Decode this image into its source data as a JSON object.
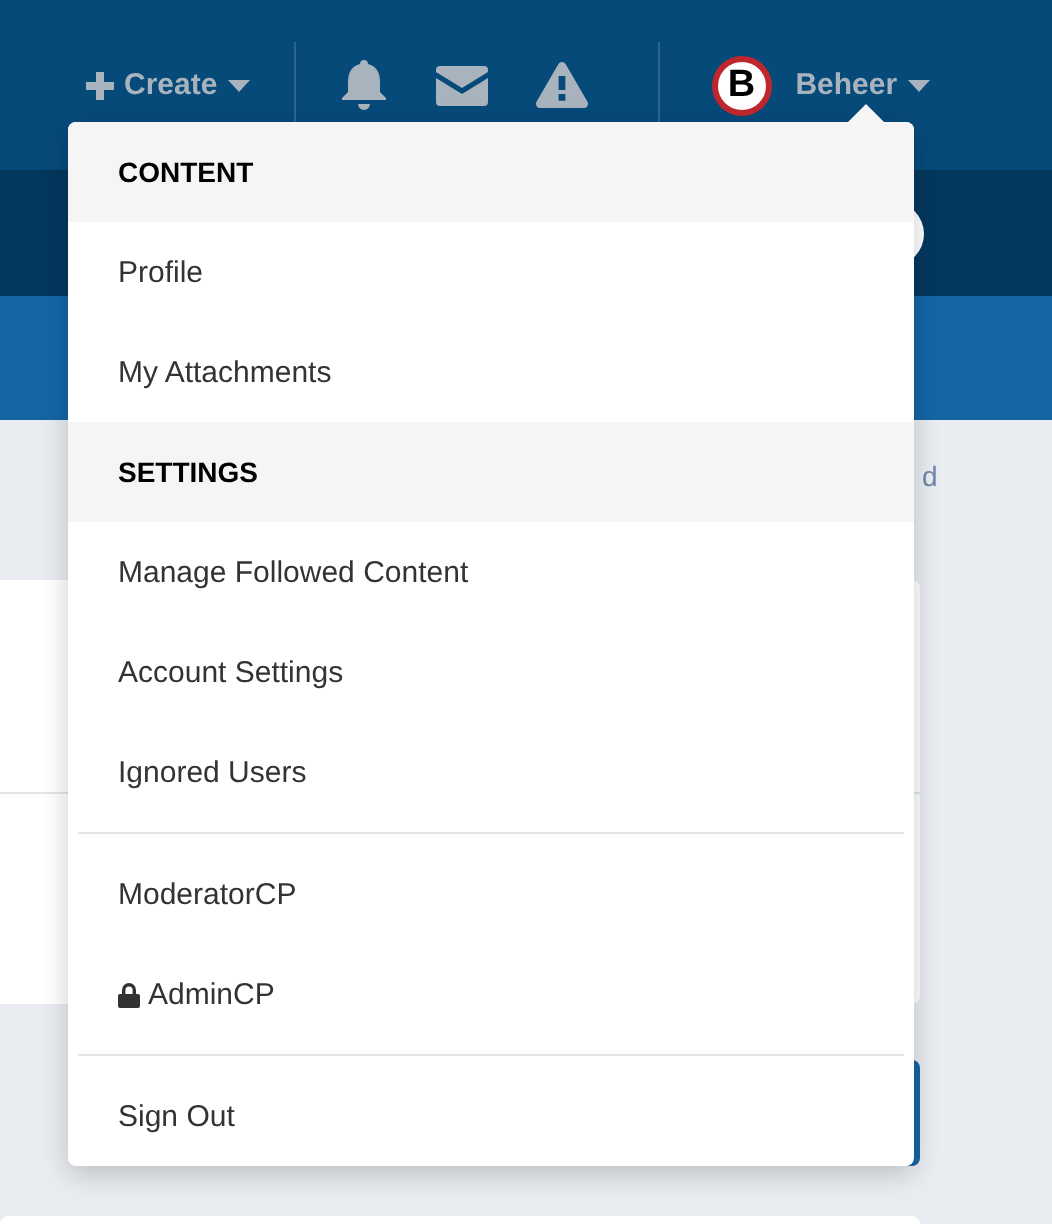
{
  "header": {
    "create_label": "Create",
    "user_name": "Beheer",
    "avatar_letter": "B"
  },
  "background_fragment": "d",
  "menu": [
    {
      "kind": "heading",
      "label": "CONTENT"
    },
    {
      "kind": "link",
      "label": "Profile",
      "locked": false
    },
    {
      "kind": "link",
      "label": "My Attachments",
      "locked": false
    },
    {
      "kind": "heading",
      "label": "SETTINGS"
    },
    {
      "kind": "link",
      "label": "Manage Followed Content",
      "locked": false
    },
    {
      "kind": "link",
      "label": "Account Settings",
      "locked": false
    },
    {
      "kind": "link",
      "label": "Ignored Users",
      "locked": false
    },
    {
      "kind": "divider"
    },
    {
      "kind": "link",
      "label": "ModeratorCP",
      "locked": false
    },
    {
      "kind": "link",
      "label": "AdminCP",
      "locked": true
    },
    {
      "kind": "divider"
    },
    {
      "kind": "link",
      "label": "Sign Out",
      "locked": false
    }
  ]
}
